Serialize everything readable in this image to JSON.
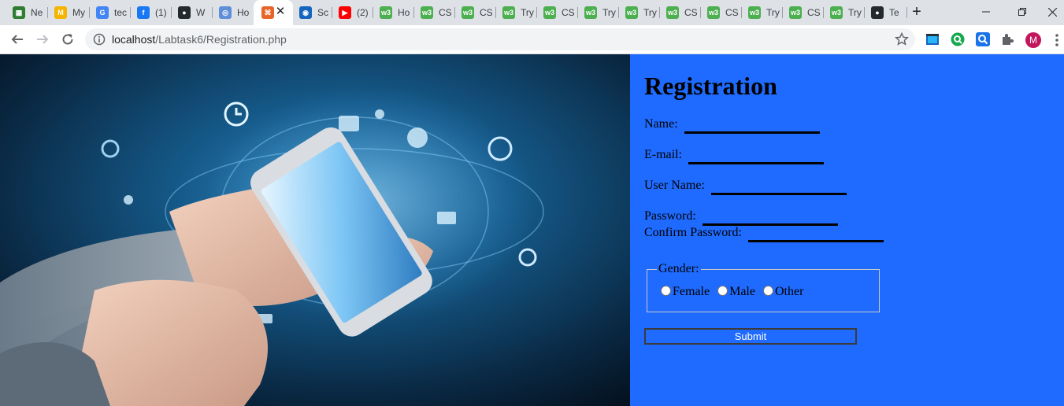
{
  "browser": {
    "tabs": [
      {
        "label": "Ne",
        "icon": "film-icon",
        "color": "#2e7d32"
      },
      {
        "label": "My",
        "icon": "mw-icon",
        "color": "#f5b400"
      },
      {
        "label": "tec",
        "icon": "google-icon",
        "color": "#4285f4"
      },
      {
        "label": "(1)",
        "icon": "facebook-icon",
        "color": "#1877f2"
      },
      {
        "label": "W",
        "icon": "github-icon",
        "color": "#24292e"
      },
      {
        "label": "Ho",
        "icon": "compass-icon",
        "color": "#5f8fd9"
      },
      {
        "label": "",
        "icon": "w3-orange-icon",
        "color": "#e8652a"
      },
      {
        "label": "Sc",
        "icon": "sc-icon",
        "color": "#1565c0"
      },
      {
        "label": "(2)",
        "icon": "youtube-icon",
        "color": "#ff0000"
      },
      {
        "label": "Ho",
        "icon": "w3schools-icon",
        "color": "#4caf50"
      },
      {
        "label": "CS",
        "icon": "w3schools-icon",
        "color": "#4caf50"
      },
      {
        "label": "CS",
        "icon": "w3schools-icon",
        "color": "#4caf50"
      },
      {
        "label": "Try",
        "icon": "w3schools-icon",
        "color": "#4caf50"
      },
      {
        "label": "CS",
        "icon": "w3schools-icon",
        "color": "#4caf50"
      },
      {
        "label": "Try",
        "icon": "w3schools-icon",
        "color": "#4caf50"
      },
      {
        "label": "Try",
        "icon": "w3schools-icon",
        "color": "#4caf50"
      },
      {
        "label": "CS",
        "icon": "w3schools-icon",
        "color": "#4caf50"
      },
      {
        "label": "CS",
        "icon": "w3schools-icon",
        "color": "#4caf50"
      },
      {
        "label": "Try",
        "icon": "w3schools-icon",
        "color": "#4caf50"
      },
      {
        "label": "CS",
        "icon": "w3schools-icon",
        "color": "#4caf50"
      },
      {
        "label": "Try",
        "icon": "w3schools-icon",
        "color": "#4caf50"
      },
      {
        "label": "Te",
        "icon": "github-icon",
        "color": "#24292e"
      }
    ],
    "active_tab": 6,
    "new_tab": "+",
    "url_host": "localhost",
    "url_path": "/Labtask6/Registration.php",
    "avatar_letter": "M"
  },
  "form": {
    "title": "Registration",
    "name_label": "Name:",
    "email_label": "E-mail:",
    "username_label": "User Name:",
    "password_label": "Password:",
    "confirm_label": "Confirm Password:",
    "gender_legend": "Gender:",
    "gender_options": [
      "Female",
      "Male",
      "Other"
    ],
    "submit_label": "Submit",
    "panel_color": "#1f6bff"
  }
}
